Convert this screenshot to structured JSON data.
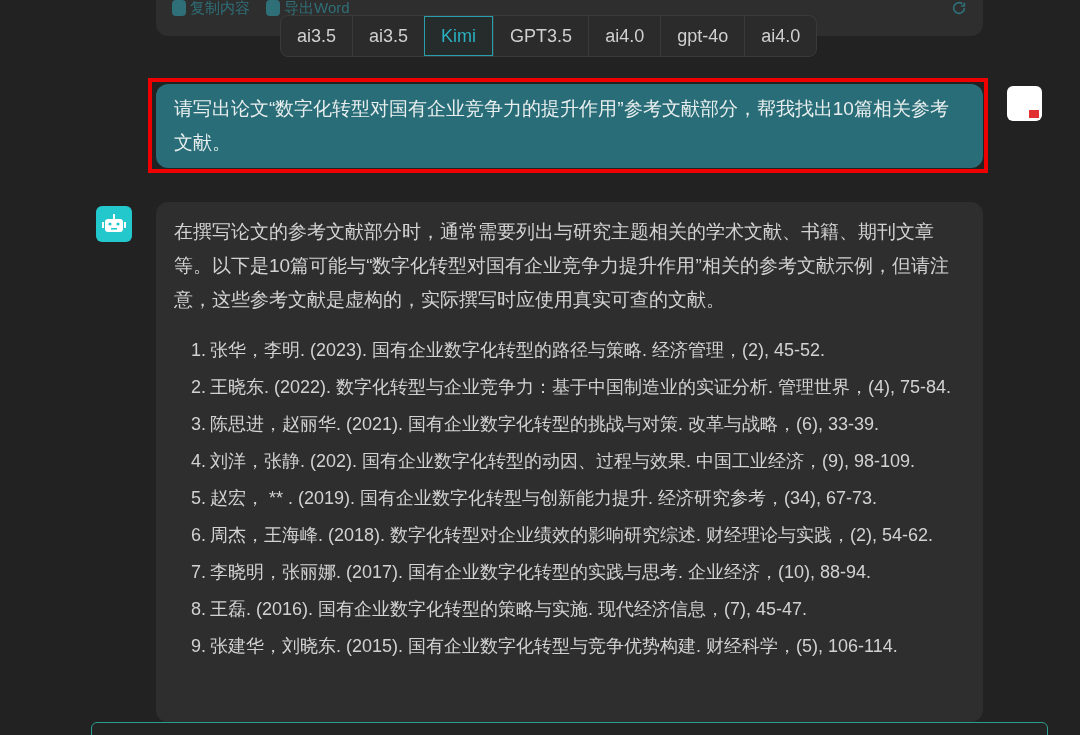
{
  "previous_card": {
    "actions": [
      "复制内容",
      "导出Word"
    ]
  },
  "model_tabs": [
    {
      "label": "ai3.5",
      "selected": false
    },
    {
      "label": "ai3.5",
      "selected": false
    },
    {
      "label": "Kimi",
      "selected": true
    },
    {
      "label": "GPT3.5",
      "selected": false
    },
    {
      "label": "ai4.0",
      "selected": false
    },
    {
      "label": "gpt-4o",
      "selected": false
    },
    {
      "label": "ai4.0",
      "selected": false
    }
  ],
  "user_message": {
    "text": "请写出论文“数字化转型对国有企业竞争力的提升作用”参考文献部分，帮我找出10篇相关参考文献。",
    "highlighted": true
  },
  "assistant_message": {
    "intro": "在撰写论文的参考文献部分时，通常需要列出与研究主题相关的学术文献、书籍、期刊文章等。以下是10篇可能与“数字化转型对国有企业竞争力提升作用”相关的参考文献示例，但请注意，这些参考文献是虚构的，实际撰写时应使用真实可查的文献。",
    "references": [
      {
        "number": "1.",
        "text": "张华，李明. (2023). 国有企业数字化转型的路径与策略. 经济管理，(2), 45-52."
      },
      {
        "number": "2.",
        "text": "王晓东. (2022). 数字化转型与企业竞争力：基于中国制造业的实证分析. 管理世界，(4), 75-84."
      },
      {
        "number": "3.",
        "text": "陈思进，赵丽华. (2021). 国有企业数字化转型的挑战与对策. 改革与战略，(6), 33-39."
      },
      {
        "number": "4.",
        "text": "刘洋，张静. (202). 国有企业数字化转型的动因、过程与效果. 中国工业经济，(9), 98-109."
      },
      {
        "number": "5.",
        "text": "赵宏， ** . (2019). 国有企业数字化转型与创新能力提升. 经济研究参考，(34), 67-73."
      },
      {
        "number": "6.",
        "text": "周杰，王海峰. (2018). 数字化转型对企业绩效的影响研究综述. 财经理论与实践，(2), 54-62."
      },
      {
        "number": "7.",
        "text": "李晓明，张丽娜. (2017). 国有企业数字化转型的实践与思考. 企业经济，(10), 88-94."
      },
      {
        "number": "8.",
        "text": "王磊. (2016). 国有企业数字化转型的策略与实施. 现代经济信息，(7), 45-47."
      },
      {
        "number": "9.",
        "text": "张建华，刘晓东. (2015). 国有企业数字化转型与竞争优势构建. 财经科学，(5), 106-114."
      }
    ]
  }
}
